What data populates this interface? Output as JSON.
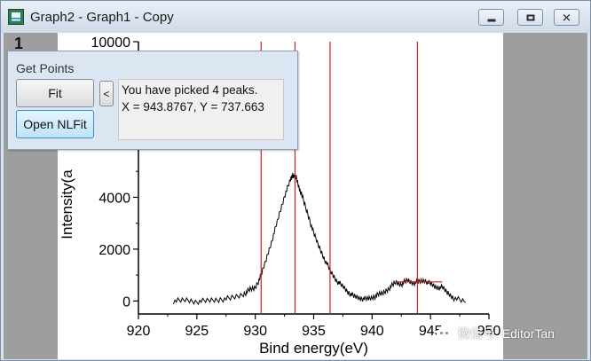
{
  "window": {
    "title": "Graph2 - Graph1 - Copy",
    "layer_number": "1"
  },
  "dialog": {
    "title": "Get Points",
    "fit_label": "Fit",
    "open_nlfit_label": "Open NLFit",
    "collapse_label": "<",
    "message_lines": [
      "You have picked 4 peaks.",
      "X = 943.8767, Y = 737.663"
    ]
  },
  "watermark": {
    "text": "微信号: EditorTan"
  },
  "colors": {
    "peak_line": "#cc1f1f",
    "curve": "#000000",
    "dialog_bg": "#dbe6f2",
    "page_bg": "#9e9e9e"
  },
  "chart_data": {
    "type": "line",
    "xlabel": "Bind energy(eV)",
    "ylabel": "Intensity(a",
    "xlim": [
      920,
      950
    ],
    "ylim": [
      -500,
      10000
    ],
    "x_ticks": [
      "920",
      "925",
      "930",
      "935",
      "940",
      "945",
      "950"
    ],
    "y_ticks": [
      "0",
      "2000",
      "4000",
      "10000"
    ],
    "peak_markers_x": [
      930.5,
      933.4,
      936.4,
      943.88
    ],
    "baseline_segment": {
      "x": [
        942,
        946
      ],
      "y": 737.663
    },
    "series": [
      {
        "x": [
          923,
          924,
          925,
          926,
          927,
          928,
          929,
          929.5,
          930,
          930.5,
          931,
          931.5,
          932,
          932.5,
          933,
          933.2,
          933.5,
          933.8,
          934,
          934.5,
          935,
          935.5,
          936,
          936.5,
          937,
          937.5,
          938,
          938.5,
          939,
          939.5,
          940,
          940.5,
          941,
          941.5,
          942,
          942.5,
          943,
          943.5,
          944,
          944.5,
          945,
          945.5,
          946,
          946.5,
          947,
          948
        ],
        "y": [
          -10,
          40,
          -20,
          20,
          60,
          110,
          260,
          420,
          520,
          980,
          1700,
          2450,
          3250,
          4050,
          4650,
          4880,
          4750,
          4300,
          4050,
          3350,
          2600,
          2050,
          1550,
          1100,
          770,
          560,
          320,
          170,
          110,
          70,
          130,
          230,
          320,
          520,
          720,
          650,
          800,
          700,
          740,
          790,
          660,
          520,
          520,
          300,
          120,
          -40
        ]
      }
    ]
  }
}
